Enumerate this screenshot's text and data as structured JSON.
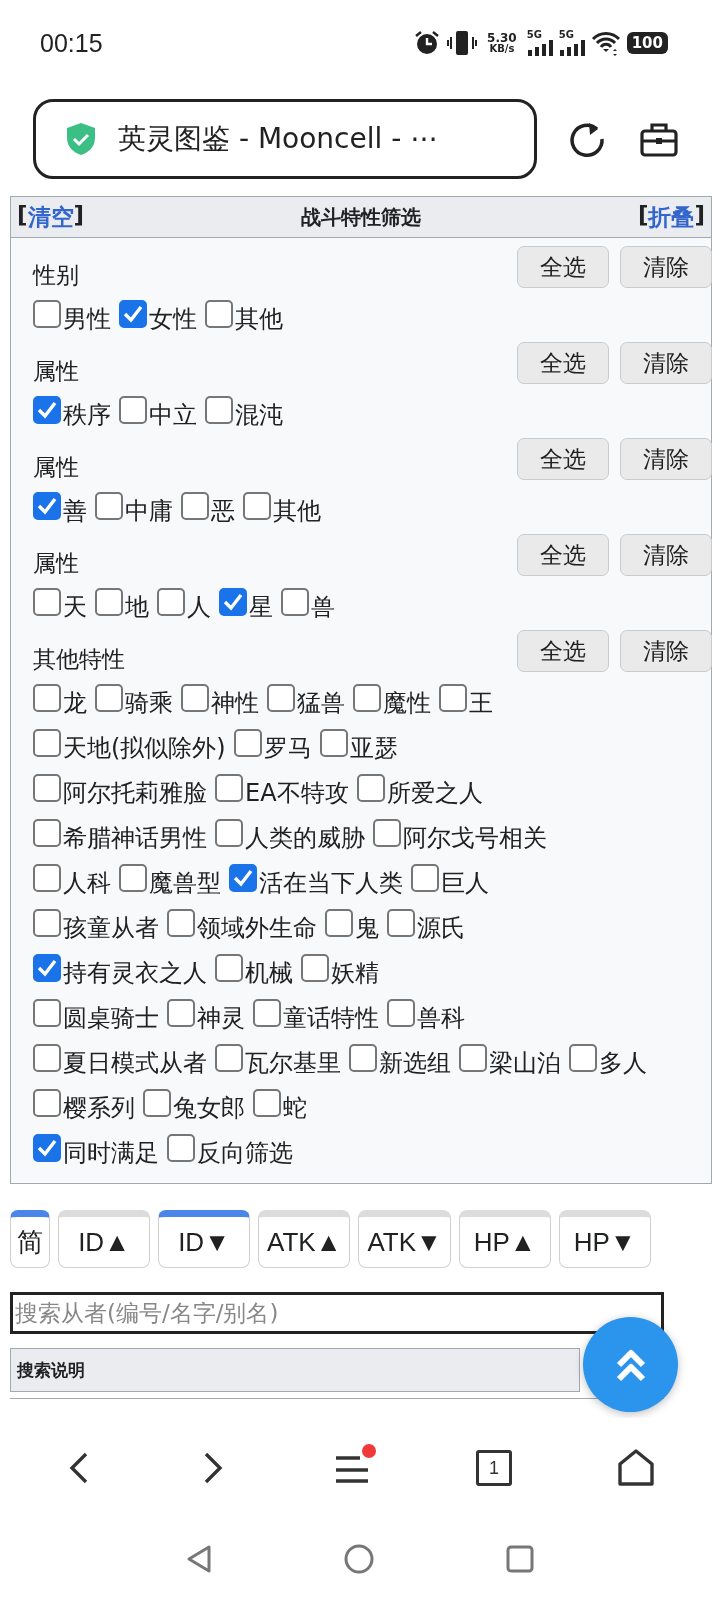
{
  "status_bar": {
    "time": "00:15",
    "speed_value": "5.30",
    "speed_unit": "KB/s",
    "networks": [
      "5G",
      "5G"
    ],
    "battery": "100"
  },
  "address_bar": {
    "title": "英灵图鉴 - Mooncell - ⋯"
  },
  "filter_panel": {
    "clear_link": {
      "open": "[",
      "label": "清空",
      "close": "]"
    },
    "title": "战斗特性筛选",
    "collapse_link": {
      "open": "[",
      "label": "折叠",
      "close": "]"
    },
    "groups": [
      {
        "label": "性别",
        "buttons": [
          "全选",
          "清除"
        ],
        "rows": [
          [
            {
              "label": "男性",
              "checked": false
            },
            {
              "label": "女性",
              "checked": true
            },
            {
              "label": "其他",
              "checked": false
            }
          ]
        ]
      },
      {
        "label": "属性",
        "buttons": [
          "全选",
          "清除"
        ],
        "rows": [
          [
            {
              "label": "秩序",
              "checked": true
            },
            {
              "label": "中立",
              "checked": false
            },
            {
              "label": "混沌",
              "checked": false
            }
          ]
        ]
      },
      {
        "label": "属性",
        "buttons": [
          "全选",
          "清除"
        ],
        "rows": [
          [
            {
              "label": "善",
              "checked": true
            },
            {
              "label": "中庸",
              "checked": false
            },
            {
              "label": "恶",
              "checked": false
            },
            {
              "label": "其他",
              "checked": false
            }
          ]
        ]
      },
      {
        "label": "属性",
        "buttons": [
          "全选",
          "清除"
        ],
        "rows": [
          [
            {
              "label": "天",
              "checked": false
            },
            {
              "label": "地",
              "checked": false
            },
            {
              "label": "人",
              "checked": false
            },
            {
              "label": "星",
              "checked": true
            },
            {
              "label": "兽",
              "checked": false
            }
          ]
        ]
      },
      {
        "label": "其他特性",
        "buttons": [
          "全选",
          "清除"
        ],
        "rows": [
          [
            {
              "label": "龙",
              "checked": false
            },
            {
              "label": "骑乘",
              "checked": false
            },
            {
              "label": "神性",
              "checked": false
            },
            {
              "label": "猛兽",
              "checked": false
            },
            {
              "label": "魔性",
              "checked": false
            },
            {
              "label": "王",
              "checked": false
            }
          ],
          [
            {
              "label": "天地(拟似除外)",
              "checked": false
            },
            {
              "label": "罗马",
              "checked": false
            },
            {
              "label": "亚瑟",
              "checked": false
            }
          ],
          [
            {
              "label": "阿尔托莉雅脸",
              "checked": false
            },
            {
              "label": "EA不特攻",
              "checked": false
            },
            {
              "label": "所爱之人",
              "checked": false
            }
          ],
          [
            {
              "label": "希腊神话男性",
              "checked": false
            },
            {
              "label": "人类的威胁",
              "checked": false
            },
            {
              "label": "阿尔戈号相关",
              "checked": false
            }
          ],
          [
            {
              "label": "人科",
              "checked": false
            },
            {
              "label": "魔兽型",
              "checked": false
            },
            {
              "label": "活在当下人类",
              "checked": true
            },
            {
              "label": "巨人",
              "checked": false
            }
          ],
          [
            {
              "label": "孩童从者",
              "checked": false
            },
            {
              "label": "领域外生命",
              "checked": false
            },
            {
              "label": "鬼",
              "checked": false
            },
            {
              "label": "源氏",
              "checked": false
            }
          ],
          [
            {
              "label": "持有灵衣之人",
              "checked": true
            },
            {
              "label": "机械",
              "checked": false
            },
            {
              "label": "妖精",
              "checked": false
            }
          ],
          [
            {
              "label": "圆桌骑士",
              "checked": false
            },
            {
              "label": "神灵",
              "checked": false
            },
            {
              "label": "童话特性",
              "checked": false
            },
            {
              "label": "兽科",
              "checked": false
            }
          ],
          [
            {
              "label": "夏日模式从者",
              "checked": false
            },
            {
              "label": "瓦尔基里",
              "checked": false
            },
            {
              "label": "新选组",
              "checked": false
            },
            {
              "label": "梁山泊",
              "checked": false
            },
            {
              "label": "多人",
              "checked": false
            }
          ],
          [
            {
              "label": "樱系列",
              "checked": false
            },
            {
              "label": "兔女郎",
              "checked": false
            },
            {
              "label": "蛇",
              "checked": false
            }
          ],
          [
            {
              "label": "同时满足",
              "checked": true
            },
            {
              "label": "反向筛选",
              "checked": false
            }
          ]
        ]
      }
    ]
  },
  "sort_buttons": [
    {
      "label": "简",
      "selected": true
    },
    {
      "label": "ID▲",
      "selected": false
    },
    {
      "label": "ID▼",
      "selected": true
    },
    {
      "label": "ATK▲",
      "selected": false
    },
    {
      "label": "ATK▼",
      "selected": false
    },
    {
      "label": "HP▲",
      "selected": false
    },
    {
      "label": "HP▼",
      "selected": false
    }
  ],
  "search": {
    "placeholder": "搜索从者(编号/名字/别名)"
  },
  "search_help": {
    "title": "搜索说明"
  },
  "bottom_nav": {
    "tab_count": "1",
    "menu_badge": true
  }
}
